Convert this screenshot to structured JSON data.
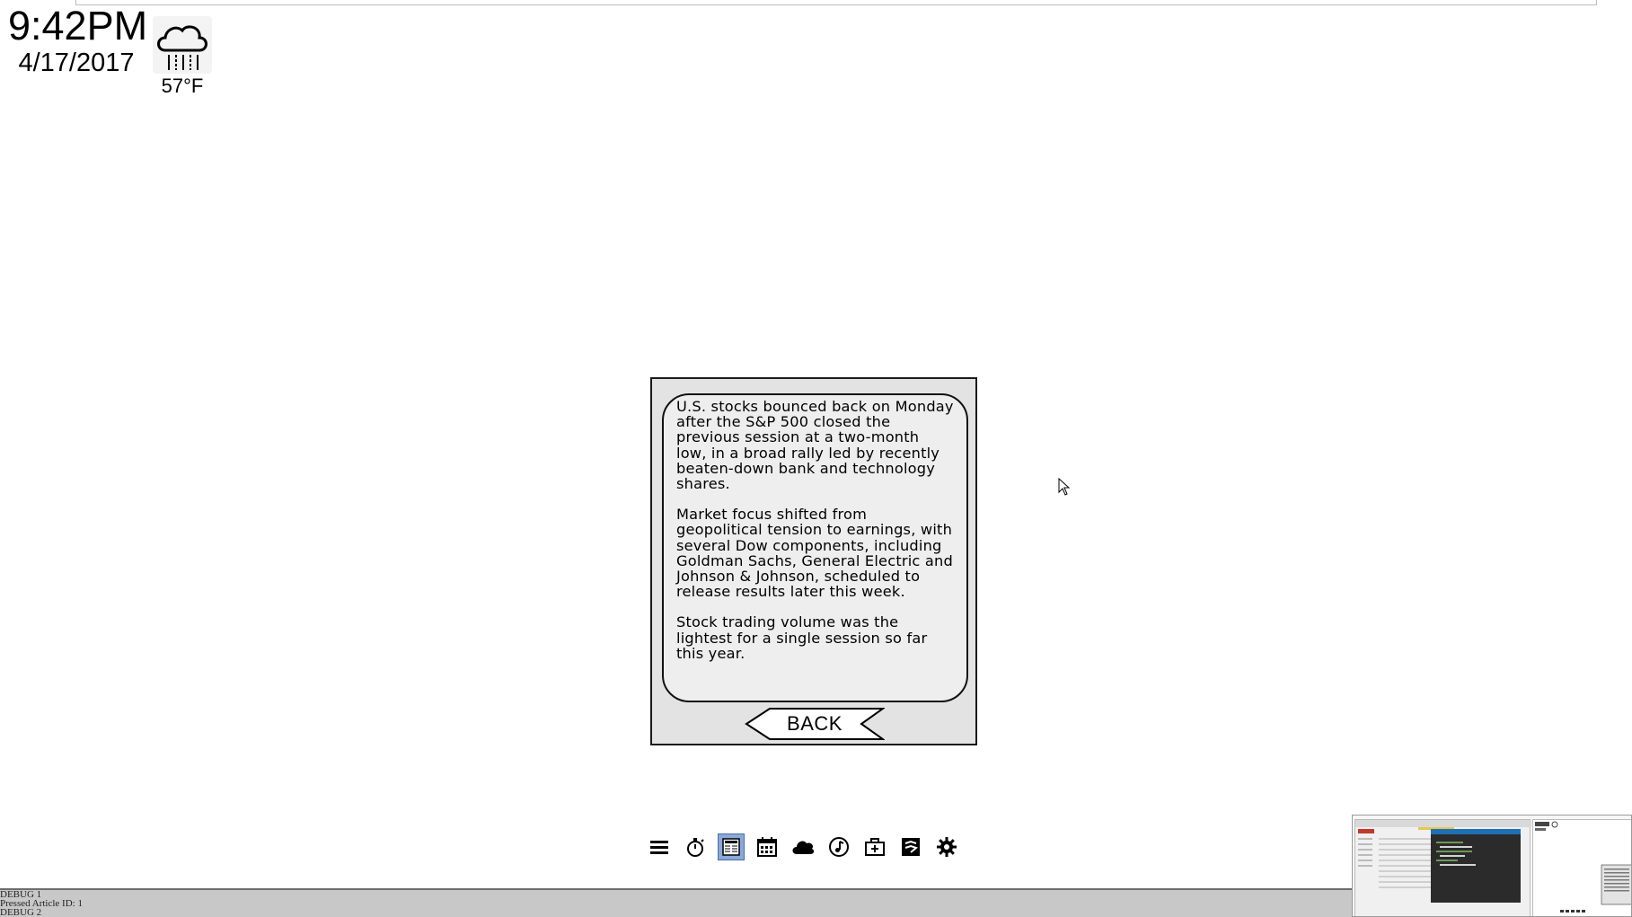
{
  "clock": {
    "time": "9:42PM",
    "date": "4/17/2017"
  },
  "weather": {
    "icon": "rain-cloud-icon",
    "temperature": "57°F"
  },
  "article": {
    "paragraphs": [
      "U.S. stocks bounced back on Monday after the S&P 500 closed the previous session at a two-month low, in a broad rally led by recently beaten-down bank and technology shares.",
      "Market focus shifted from geopolitical tension to earnings, with several Dow components, including Goldman Sachs, General Electric and Johnson & Johnson, scheduled to release results later this week.",
      "Stock trading volume was the lightest for a single session so far this year."
    ],
    "back_label": "BACK"
  },
  "dock": {
    "items": [
      {
        "icon": "menu-icon",
        "active": false
      },
      {
        "icon": "stopwatch-icon",
        "active": false
      },
      {
        "icon": "news-icon",
        "active": true
      },
      {
        "icon": "calendar-icon",
        "active": false
      },
      {
        "icon": "cloud-icon",
        "active": false
      },
      {
        "icon": "music-icon",
        "active": false
      },
      {
        "icon": "medical-kit-icon",
        "active": false
      },
      {
        "icon": "stock-icon",
        "active": false
      },
      {
        "icon": "settings-icon",
        "active": false
      }
    ],
    "active_color": "#8aa9d8"
  },
  "debug": {
    "lines": [
      "DEBUG 1",
      "Pressed Article ID: 1",
      "DEBUG 2"
    ]
  }
}
